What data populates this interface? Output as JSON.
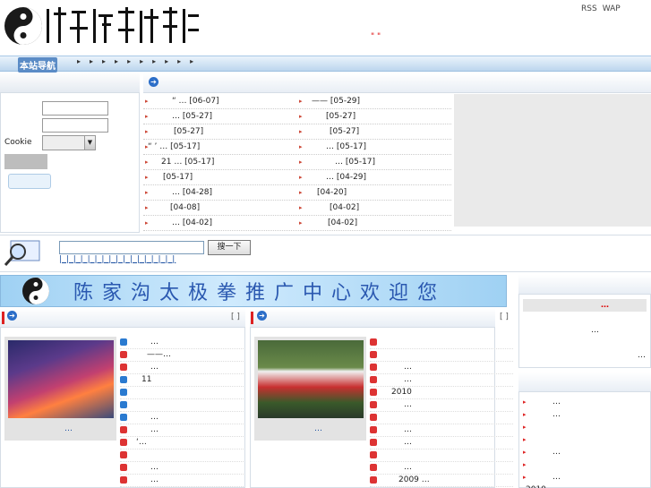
{
  "header": {
    "rss": "RSS",
    "wap": "WAP",
    "quote": "\"   \""
  },
  "nav": {
    "title": "本站导航",
    "items": [
      "▸",
      "▸",
      "▸",
      "▸",
      "▸",
      "▸",
      "▸",
      "▸",
      "▸",
      "▸"
    ]
  },
  "login": {
    "cookie_label": "Cookie",
    "cookie_select": ""
  },
  "news": {
    "left": [
      {
        "text": "“ … [06-07]",
        "bullet": "▸"
      },
      {
        "text": "… [05-27]",
        "bullet": "▸"
      },
      {
        "text": "[05-27]",
        "bullet": "▸"
      },
      {
        "text": "“ ’      … [05-17]",
        "bullet": "▸"
      },
      {
        "text": "21   … [05-17]",
        "bullet": "▸"
      },
      {
        "text": "[05-17]",
        "bullet": "▸"
      },
      {
        "text": "… [04-28]",
        "bullet": "▸"
      },
      {
        "text": "[04-08]",
        "bullet": "▸"
      },
      {
        "text": "… [04-02]",
        "bullet": "▸"
      }
    ],
    "right": [
      {
        "text": "——     [05-29]",
        "bullet": "▸"
      },
      {
        "text": "[05-27]",
        "bullet": "▸"
      },
      {
        "text": "[05-27]",
        "bullet": "▸"
      },
      {
        "text": "… [05-17]",
        "bullet": "▸"
      },
      {
        "text": "… [05-17]",
        "bullet": "▸"
      },
      {
        "text": "… [04-29]",
        "bullet": "▸"
      },
      {
        "text": "[04-20]",
        "bullet": "▸"
      },
      {
        "text": "[04-02]",
        "bullet": "▸"
      },
      {
        "text": "[04-02]",
        "bullet": "▸"
      }
    ]
  },
  "search": {
    "button": "搜一下",
    "value": "",
    "links": "| | | | |  | | | | | | | | | | | |"
  },
  "banner": {
    "text": "陈家沟太极拳推广中心欢迎您"
  },
  "panels": {
    "left": {
      "more": "[ ]",
      "caption": "…",
      "items": [
        {
          "text": "…",
          "icon": "b"
        },
        {
          "text": "——…",
          "icon": "r"
        },
        {
          "text": "…",
          "icon": "r"
        },
        {
          "text": "11",
          "icon": "b"
        },
        {
          "text": "",
          "icon": "b"
        },
        {
          "text": "",
          "icon": "b"
        },
        {
          "text": "…",
          "icon": "b"
        },
        {
          "text": "…",
          "icon": "r"
        },
        {
          "text": "‘…",
          "icon": "r"
        },
        {
          "text": "",
          "icon": "r"
        },
        {
          "text": "…",
          "icon": "r"
        },
        {
          "text": "…",
          "icon": "r"
        }
      ]
    },
    "right": {
      "more": "[ ]",
      "caption": "…",
      "items": [
        {
          "text": "",
          "icon": "r"
        },
        {
          "text": "",
          "icon": "r"
        },
        {
          "text": "…",
          "icon": "r"
        },
        {
          "text": "…",
          "icon": "r"
        },
        {
          "text": "2010",
          "icon": "r"
        },
        {
          "text": "…",
          "icon": "r"
        },
        {
          "text": "",
          "icon": "r"
        },
        {
          "text": "…",
          "icon": "r"
        },
        {
          "text": "…",
          "icon": "r"
        },
        {
          "text": "",
          "icon": "r"
        },
        {
          "text": "…",
          "icon": "r"
        },
        {
          "text": "2009 …",
          "icon": "r"
        }
      ]
    }
  },
  "right_box1": {
    "highlight": "…",
    "line1": "…",
    "line2": "…"
  },
  "right_box2": {
    "items": [
      "…",
      "…",
      "",
      "",
      "…",
      "",
      "…",
      "2010"
    ]
  }
}
